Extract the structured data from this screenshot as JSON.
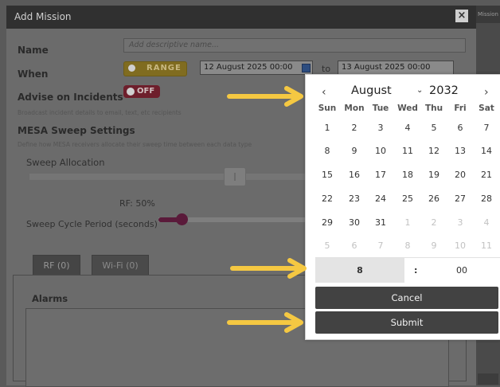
{
  "dialog": {
    "title": "Add Mission",
    "close_icon": "close-icon",
    "name_label": "Name",
    "name_placeholder": "Add descriptive name...",
    "when_label": "When",
    "range_label": "RANGE",
    "start_date": "12 August 2025 00:00",
    "to_label": "to",
    "end_date": "13 August 2025 00:00",
    "advise_label": "Advise on Incidents",
    "advise_toggle": "OFF",
    "advise_desc": "Broadcast incident details to email, text, etc recipients",
    "mesa_title": "MESA Sweep Settings",
    "mesa_desc": "Define how MESA receivers allocate their sweep time between each data type",
    "sweep_alloc_label": "Sweep Allocation",
    "rf_percent": "RF: 50%",
    "cycle_label": "Sweep Cycle Period (seconds)",
    "tabs": [
      "RF (0)",
      "Wi-Fi (0)"
    ],
    "alarms_label": "Alarms"
  },
  "right_strip": {
    "top_label": "Mission"
  },
  "datepicker": {
    "prev": "‹",
    "next": "›",
    "month": "August",
    "year": "2032",
    "weekdays": [
      "Sun",
      "Mon",
      "Tue",
      "Wed",
      "Thu",
      "Fri",
      "Sat"
    ],
    "weeks": [
      [
        {
          "d": "1",
          "out": false
        },
        {
          "d": "2",
          "out": false
        },
        {
          "d": "3",
          "out": false
        },
        {
          "d": "4",
          "out": false
        },
        {
          "d": "5",
          "out": false
        },
        {
          "d": "6",
          "out": false
        },
        {
          "d": "7",
          "out": false
        }
      ],
      [
        {
          "d": "8",
          "out": false
        },
        {
          "d": "9",
          "out": false
        },
        {
          "d": "10",
          "out": false
        },
        {
          "d": "11",
          "out": false
        },
        {
          "d": "12",
          "out": false
        },
        {
          "d": "13",
          "out": false
        },
        {
          "d": "14",
          "out": false
        }
      ],
      [
        {
          "d": "15",
          "out": false
        },
        {
          "d": "16",
          "out": false
        },
        {
          "d": "17",
          "out": false
        },
        {
          "d": "18",
          "out": false
        },
        {
          "d": "19",
          "out": false
        },
        {
          "d": "20",
          "out": false
        },
        {
          "d": "21",
          "out": false
        }
      ],
      [
        {
          "d": "22",
          "out": false
        },
        {
          "d": "23",
          "out": false
        },
        {
          "d": "24",
          "out": false
        },
        {
          "d": "25",
          "out": false
        },
        {
          "d": "26",
          "out": false
        },
        {
          "d": "27",
          "out": false
        },
        {
          "d": "28",
          "out": false
        }
      ],
      [
        {
          "d": "29",
          "out": false
        },
        {
          "d": "30",
          "out": false
        },
        {
          "d": "31",
          "out": false
        },
        {
          "d": "1",
          "out": true
        },
        {
          "d": "2",
          "out": true
        },
        {
          "d": "3",
          "out": true
        },
        {
          "d": "4",
          "out": true
        }
      ],
      [
        {
          "d": "5",
          "out": true
        },
        {
          "d": "6",
          "out": true
        },
        {
          "d": "7",
          "out": true
        },
        {
          "d": "8",
          "out": true
        },
        {
          "d": "9",
          "out": true
        },
        {
          "d": "10",
          "out": true
        },
        {
          "d": "11",
          "out": true
        }
      ]
    ],
    "hour": "8",
    "separator": ":",
    "minute": "00",
    "cancel": "Cancel",
    "submit": "Submit"
  },
  "colors": {
    "arrow": "#f5c842",
    "range_toggle": "#806c20",
    "off_toggle": "#6e1f2c",
    "popup_button": "#424242"
  }
}
